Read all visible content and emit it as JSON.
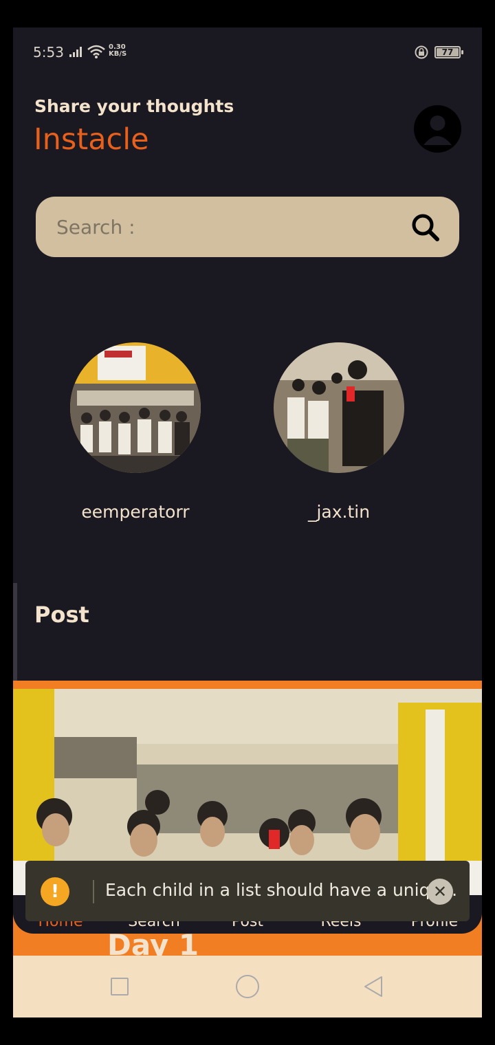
{
  "status_bar": {
    "time": "5:53",
    "speed_value": "0.30",
    "speed_unit": "KB/S",
    "battery": "77"
  },
  "header": {
    "subtitle": "Share your thoughts",
    "app_name": "Instacle"
  },
  "search": {
    "placeholder": "Search :"
  },
  "stories": [
    {
      "username": "eemperatorr"
    },
    {
      "username": "_jax.tin"
    }
  ],
  "posts": {
    "section_title": "Post",
    "caption": "Day 1"
  },
  "tabs": [
    {
      "label": "Home",
      "active": true
    },
    {
      "label": "Search",
      "active": false
    },
    {
      "label": "Post",
      "active": false
    },
    {
      "label": "Reels",
      "active": false
    },
    {
      "label": "Profile",
      "active": false
    }
  ],
  "toast": {
    "message": "Each child in a list should have a uniqu...",
    "icon": "warning-icon"
  },
  "colors": {
    "background": "#1a1820",
    "accent": "#e8601c",
    "search_bg": "#d1bf9f",
    "text_light": "#f4e3cc"
  }
}
